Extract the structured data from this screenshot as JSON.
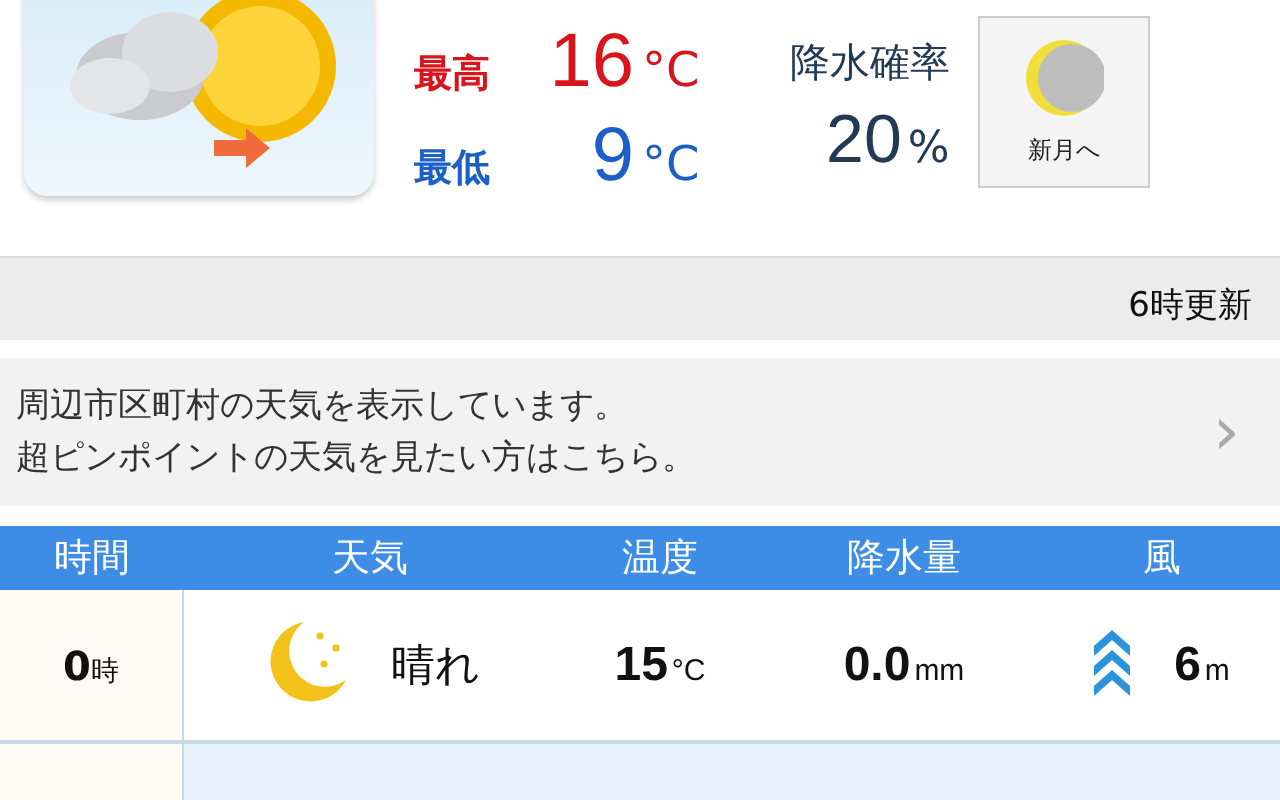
{
  "forecast": {
    "high_label": "最高",
    "high_value": "16",
    "high_unit": "°C",
    "low_label": "最低",
    "low_value": "9",
    "low_unit": "°C",
    "precip_label": "降水確率",
    "precip_value": "20",
    "precip_unit": "%",
    "moon_button": "新月へ"
  },
  "update_note": "6時更新",
  "notice": {
    "lines": [
      "周辺市区町村の天気を表示しています。",
      "超ピンポイントの天気を見たい方はこちら。"
    ],
    "chevron": "›"
  },
  "table": {
    "columns": [
      "時間",
      "天気",
      "温度",
      "降水量",
      "風"
    ],
    "rows": [
      {
        "time": "0",
        "time_unit": "時",
        "kind": "clear-night",
        "weather": "晴れ",
        "temp": "15",
        "temp_unit": "°C",
        "rain": "0.0",
        "rain_unit": "mm",
        "wind": "6",
        "wind_unit": "m"
      }
    ]
  }
}
